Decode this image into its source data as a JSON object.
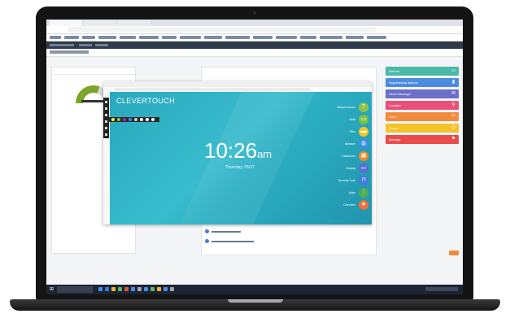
{
  "clevertouch": {
    "brand": "CLEVERTOUCH",
    "time": "10:26",
    "ampm": "am",
    "date": "Thursday, 05/07",
    "menu": [
      {
        "label": "Ideas/Lessons",
        "icon": "question-icon",
        "color": "#8bc34a",
        "glyph": "?"
      },
      {
        "label": "Note",
        "icon": "note-icon",
        "color": "#7cc242",
        "glyph": "▭"
      },
      {
        "label": "Files",
        "icon": "folder-icon",
        "color": "#f7c526",
        "glyph": "▬"
      },
      {
        "label": "Browser",
        "icon": "globe-icon",
        "color": "#3f8fe0",
        "glyph": "◍"
      },
      {
        "label": "Classroom",
        "icon": "briefcase-icon",
        "color": "#f28a24",
        "glyph": "▣"
      },
      {
        "label": "Display",
        "icon": "display-icon",
        "color": "#5b6bd6",
        "glyph": "▭"
      },
      {
        "label": "Security Lock",
        "icon": "lock-icon",
        "color": "#3f7be0",
        "glyph": "⊓"
      },
      {
        "label": "Apps",
        "icon": "apps-icon",
        "color": "#4caf50",
        "glyph": "⋮"
      },
      {
        "label": "Overview",
        "icon": "star-icon",
        "color": "#f06d3a",
        "glyph": "★"
      }
    ]
  },
  "actions": [
    {
      "label": "Reboot",
      "color": "#4cb8a6",
      "glyph": "▭"
    },
    {
      "label": "Hypothetical actions",
      "color": "#4c8ce0",
      "glyph": "▮"
    },
    {
      "label": "Send Message",
      "color": "#6a6fc9",
      "glyph": "✉"
    },
    {
      "label": "Location",
      "color": "#e8507a",
      "glyph": "⚲"
    },
    {
      "label": "Lock",
      "color": "#f08a3c",
      "glyph": "⊓"
    },
    {
      "label": "Power",
      "color": "#f5c12a",
      "glyph": "⏻"
    },
    {
      "label": "Manage",
      "color": "#e84c4c",
      "glyph": "⚑"
    }
  ]
}
